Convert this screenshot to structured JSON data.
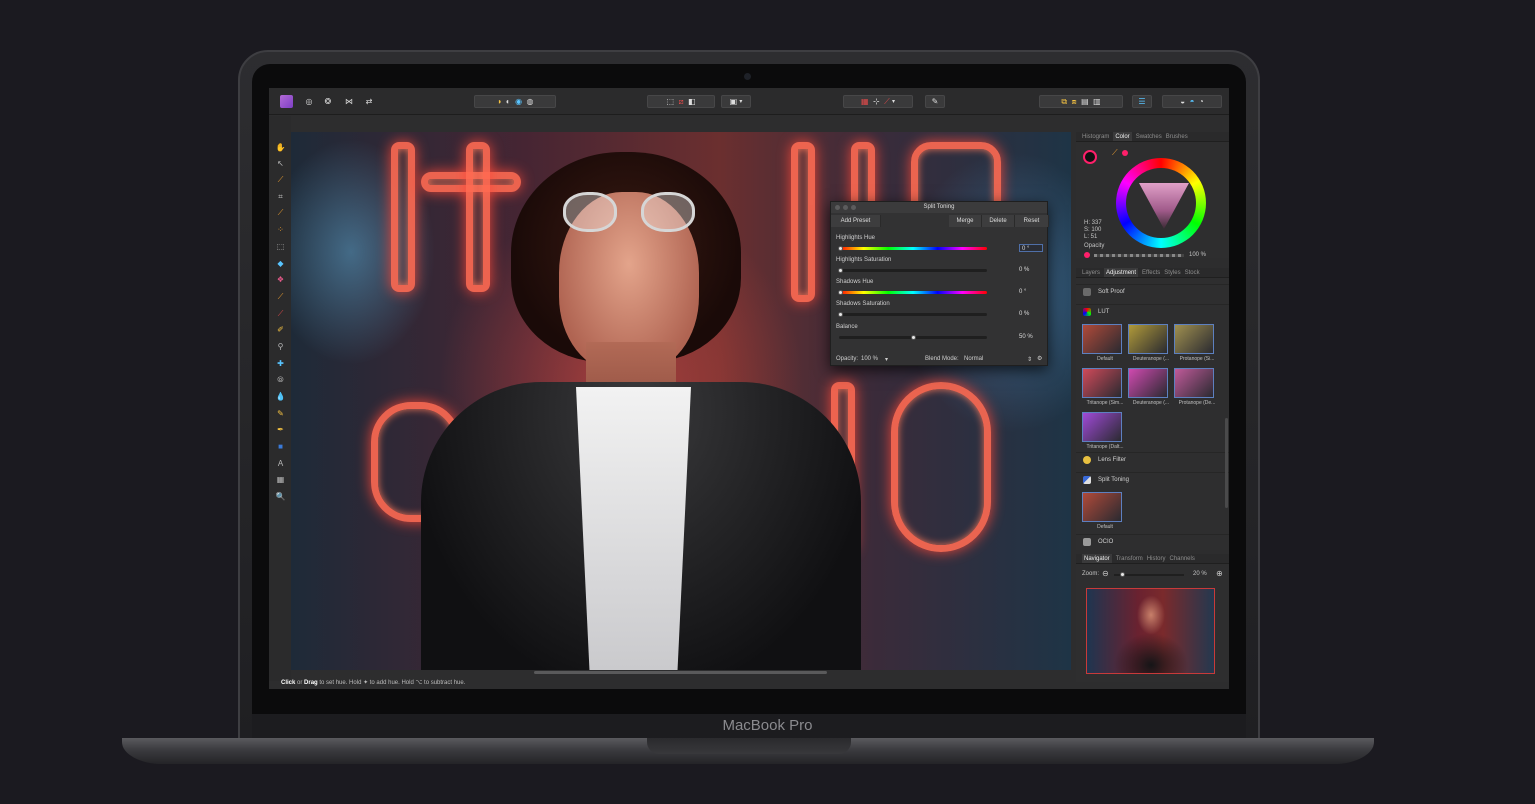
{
  "device": {
    "brand_label": "MacBook Pro"
  },
  "status_bar": {
    "click": "Click",
    "or": "or",
    "drag": "Drag",
    "rest": "to set hue. Hold ✦ to add hue. Hold ⌥ to subtract hue."
  },
  "split_toning": {
    "title": "Split Toning",
    "add_preset": "Add Preset",
    "merge": "Merge",
    "delete": "Delete",
    "reset": "Reset",
    "highlights_hue_label": "Highlights Hue",
    "highlights_hue_value": "0 °",
    "highlights_saturation_label": "Highlights Saturation",
    "highlights_saturation_value": "0 %",
    "shadows_hue_label": "Shadows Hue",
    "shadows_hue_value": "0 °",
    "shadows_saturation_label": "Shadows Saturation",
    "shadows_saturation_value": "0 %",
    "balance_label": "Balance",
    "balance_value": "50 %",
    "opacity_label": "Opacity:",
    "opacity_value": "100 %",
    "blend_mode_label": "Blend Mode:",
    "blend_mode_value": "Normal"
  },
  "color_panel": {
    "tabs": [
      "Histogram",
      "Color",
      "Swatches",
      "Brushes"
    ],
    "active_tab": "Color",
    "h": "H: 337",
    "s": "S: 100",
    "l": "L: 51",
    "opacity_label": "Opacity",
    "opacity_value": "100 %"
  },
  "adjustment_panel": {
    "tabs": [
      "Layers",
      "Adjustment",
      "Effects",
      "Styles",
      "Stock"
    ],
    "active_tab": "Adjustment",
    "soft_proof": "Soft Proof",
    "lut": "LUT",
    "lut_thumbs": [
      "Default",
      "Deuteranope (...",
      "Protanope (Si...",
      "Tritanope (Sim...",
      "Deuteranope (...",
      "Protanope (De...",
      "Tritanope (Dalt..."
    ],
    "lens_filter": "Lens Filter",
    "split_toning": "Split Toning",
    "split_thumb": "Default",
    "ocio": "OCIO"
  },
  "navigator_panel": {
    "tabs": [
      "Navigator",
      "Transform",
      "History",
      "Channels"
    ],
    "active_tab": "Navigator",
    "zoom_label": "Zoom:",
    "zoom_value": "20 %"
  },
  "colors": {
    "accent": "#ff1f6a",
    "neon": "#ff6a52",
    "selection": "#5d80c0"
  }
}
